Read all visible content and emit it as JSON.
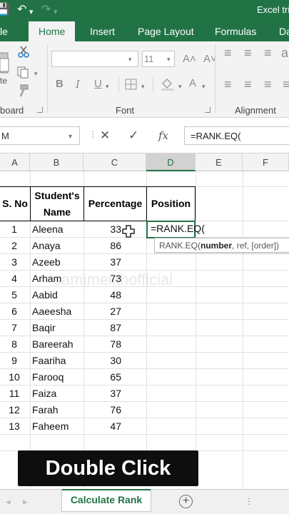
{
  "window": {
    "title": "Excel tri",
    "qat": {
      "save": "💾",
      "undo": "↶",
      "undo_chev": "▾",
      "redo": "↷",
      "redo_chev": "▾"
    }
  },
  "tabs": [
    "le",
    "Home",
    "Insert",
    "Page Layout",
    "Formulas",
    "Da"
  ],
  "active_tab": "Home",
  "ribbon": {
    "clipboard_label": "board",
    "paste_label": "te",
    "font_label": "Font",
    "alignment_label": "Alignment",
    "font_size": "11",
    "grow_font": "A˄",
    "shrink_font": "A˅",
    "bold": "B",
    "italic": "I",
    "underline": "U",
    "font_color_glyph": "A",
    "align_glyph": "≡",
    "orient_glyph": "ab↗"
  },
  "formula_bar": {
    "name_box": "M",
    "cancel_glyph": "✕",
    "enter_glyph": "✓",
    "fx_label": "fx",
    "formula": "=RANK.EQ(",
    "dots": "⋮"
  },
  "columns": [
    "A",
    "B",
    "C",
    "D",
    "E",
    "F"
  ],
  "selected_column": "D",
  "table": {
    "headers": {
      "sno": "S. No",
      "name_line1": "Student's",
      "name_line2": "Name",
      "percentage": "Percentage",
      "position": "Position"
    },
    "rows": [
      {
        "sno": "1",
        "name": "Aleena",
        "pct": "33"
      },
      {
        "sno": "2",
        "name": "Anaya",
        "pct": "86"
      },
      {
        "sno": "3",
        "name": "Azeeb",
        "pct": "37"
      },
      {
        "sno": "4",
        "name": "Arham",
        "pct": "73"
      },
      {
        "sno": "5",
        "name": "Aabid",
        "pct": "48"
      },
      {
        "sno": "6",
        "name": "Aaeesha",
        "pct": "27"
      },
      {
        "sno": "7",
        "name": "Baqir",
        "pct": "87"
      },
      {
        "sno": "8",
        "name": "Bareerah",
        "pct": "78"
      },
      {
        "sno": "9",
        "name": "Faariha",
        "pct": "30"
      },
      {
        "sno": "10",
        "name": "Farooq",
        "pct": "65"
      },
      {
        "sno": "11",
        "name": "Faiza",
        "pct": "37"
      },
      {
        "sno": "12",
        "name": "Farah",
        "pct": "76"
      },
      {
        "sno": "13",
        "name": "Faheem",
        "pct": "47"
      }
    ]
  },
  "active_cell_text": "=RANK.EQ(",
  "tooltip": {
    "prefix": "RANK.EQ(",
    "bold_arg": "number",
    "rest": ", ref, [order])"
  },
  "watermark": "samimeikhofficial",
  "banner": "Double Click",
  "sheet_tab": "Calculate Rank",
  "sheet_nav": {
    "prev": "◂",
    "next": "▸"
  },
  "add_sheet": "+",
  "sheet_dots": "⋮"
}
